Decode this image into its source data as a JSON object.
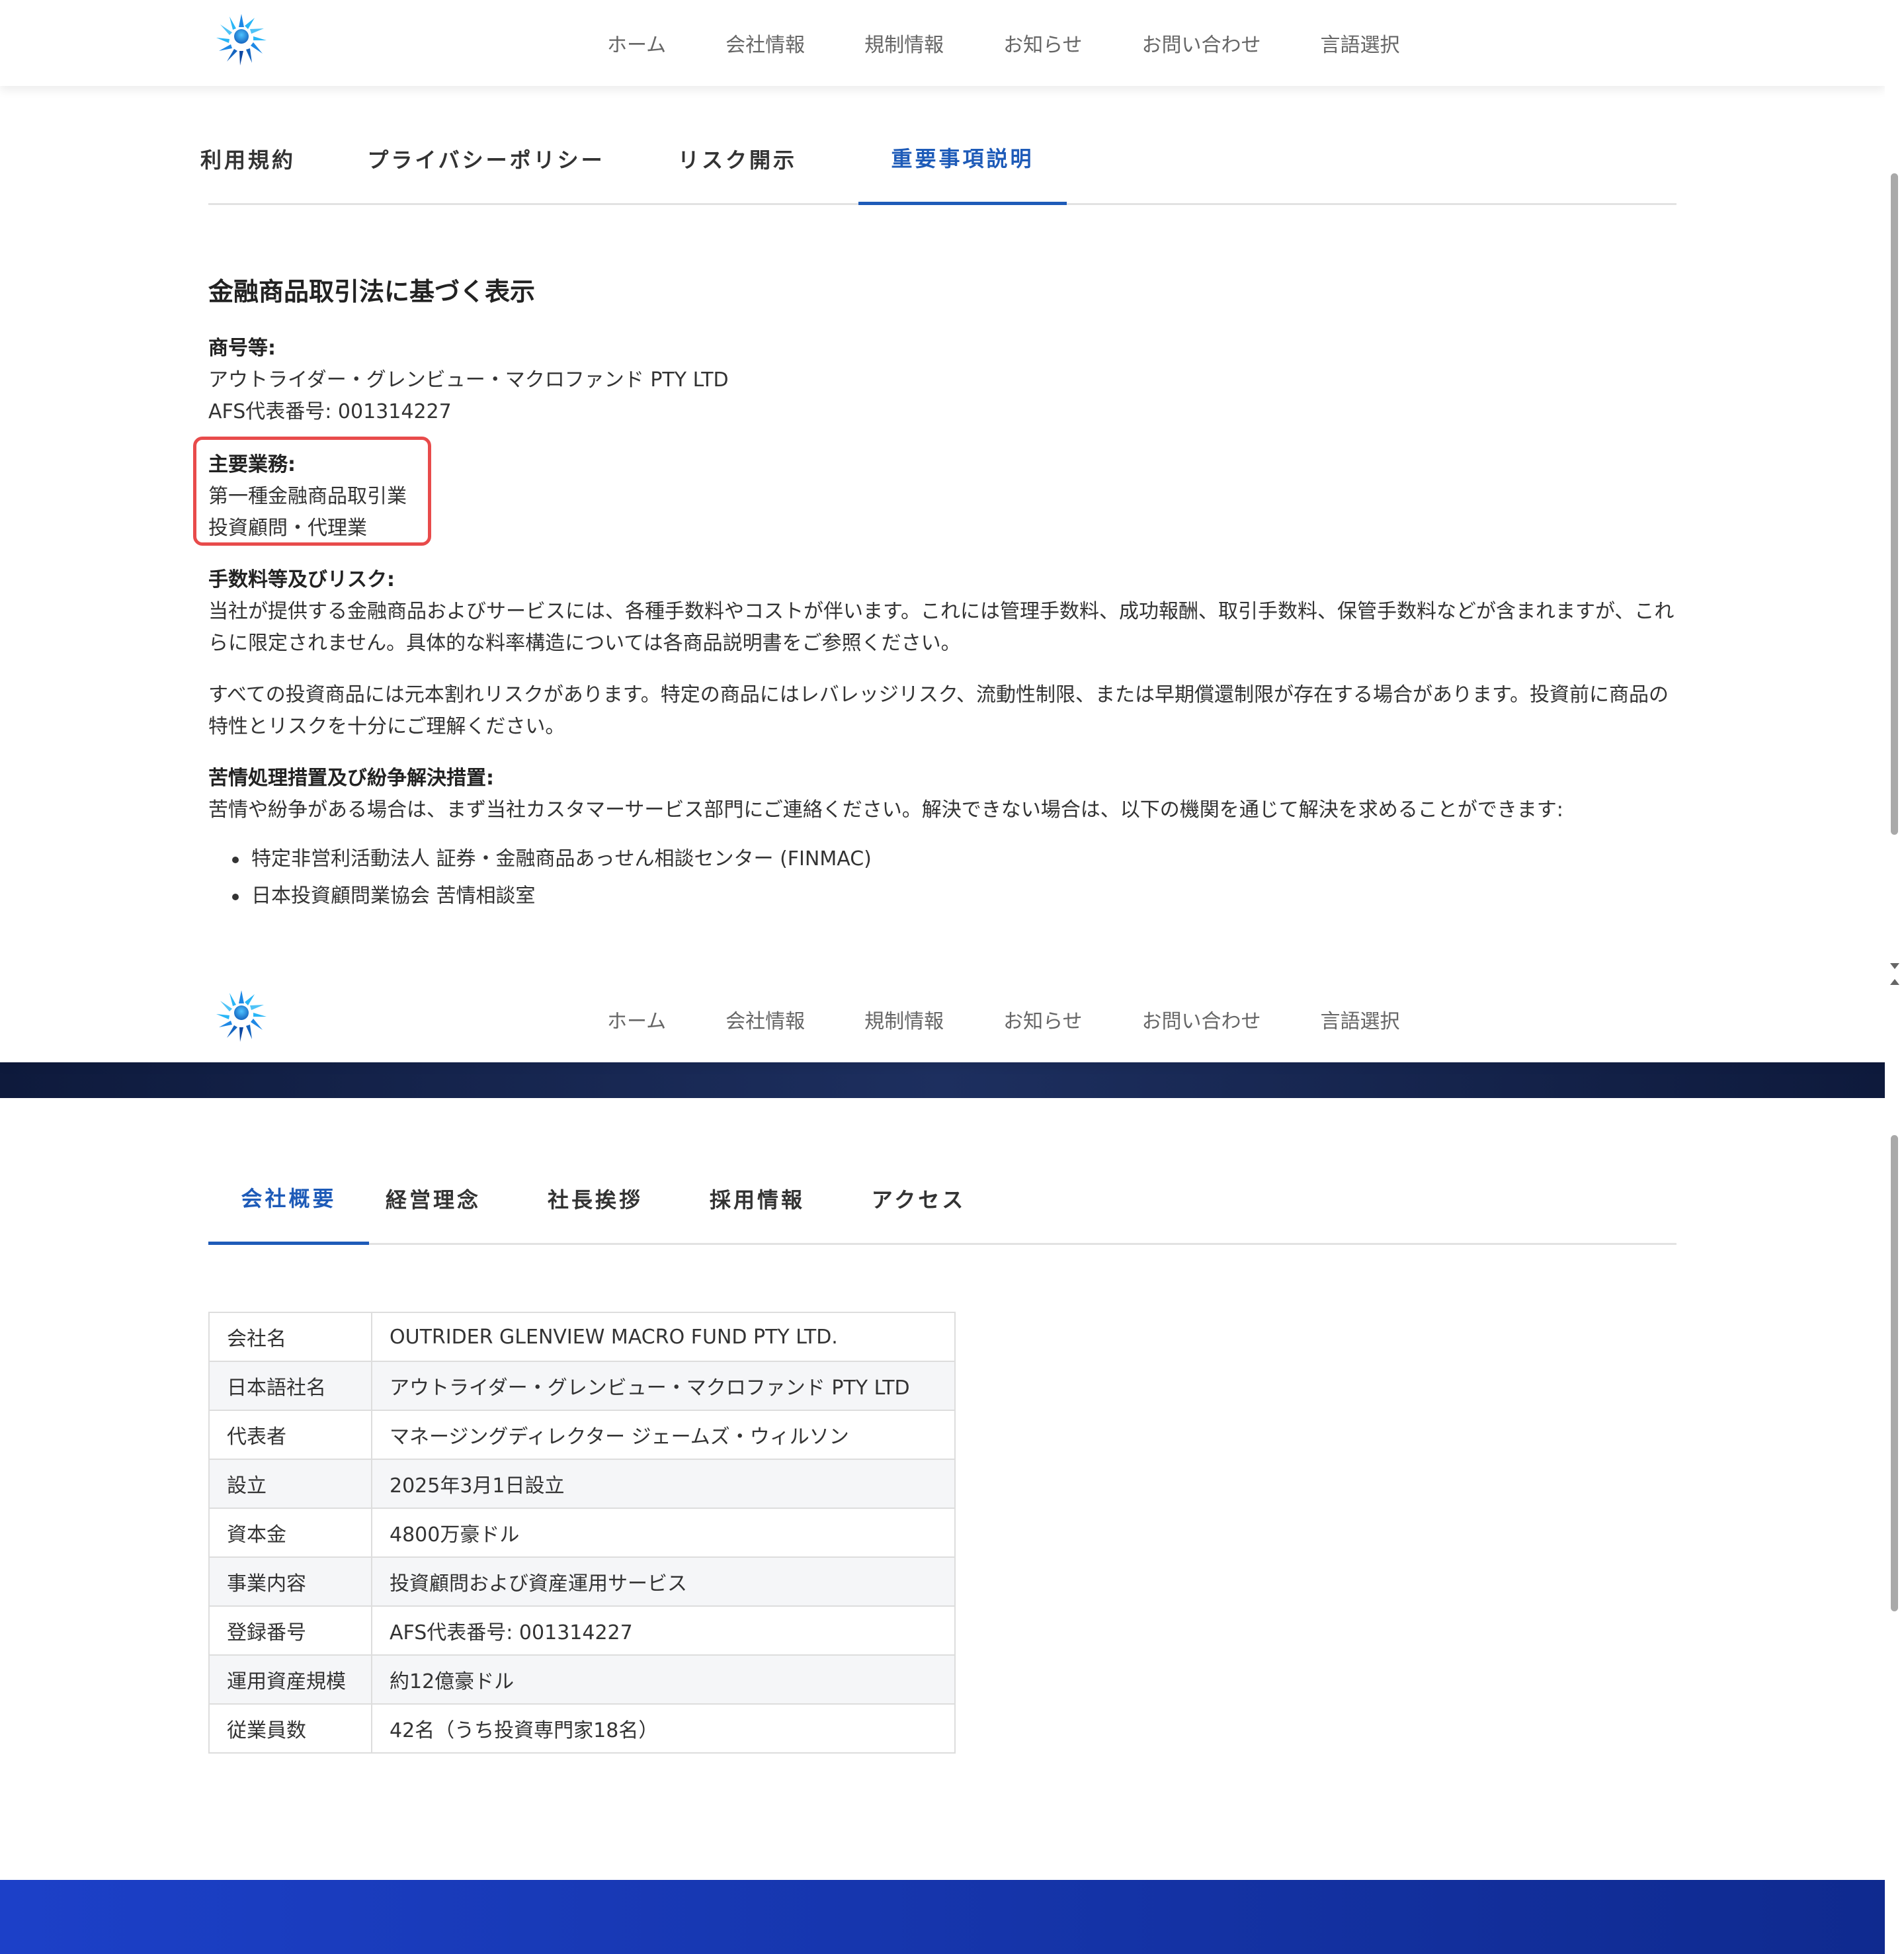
{
  "nav": [
    "ホーム",
    "会社情報",
    "規制情報",
    "お知らせ",
    "お問い合わせ",
    "言語選択"
  ],
  "pane1": {
    "tabs": [
      "利用規約",
      "プライバシーポリシー",
      "リスク開示",
      "重要事項説明"
    ],
    "active_tab": "重要事項説明",
    "heading": "金融商品取引法に基づく表示",
    "trade_name_label": "商号等:",
    "trade_name": "アウトライダー・グレンビュー・マクロファンド PTY LTD",
    "afs_number": "AFS代表番号: 001314227",
    "main_business_label": "主要業務:",
    "main_business": [
      "第一種金融商品取引業",
      "投資顧問・代理業"
    ],
    "fees_label": "手数料等及びリスク:",
    "fees_text": "当社が提供する金融商品およびサービスには、各種手数料やコストが伴います。これには管理手数料、成功報酬、取引手数料、保管手数料などが含まれますが、これらに限定されません。具体的な料率構造については各商品説明書をご参照ください。",
    "risk_text": "すべての投資商品には元本割れリスクがあります。特定の商品にはレバレッジリスク、流動性制限、または早期償還制限が存在する場合があります。投資前に商品の特性とリスクを十分にご理解ください。",
    "complaints_label": "苦情処理措置及び紛争解決措置:",
    "complaints_text": "苦情や紛争がある場合は、まず当社カスタマーサービス部門にご連絡ください。解決できない場合は、以下の機関を通じて解決を求めることができます:",
    "organizations": [
      "特定非営利活動法人 証券・金融商品あっせん相談センター (FINMAC)",
      "日本投資顧問業協会 苦情相談室"
    ]
  },
  "pane2": {
    "tabs": [
      "会社概要",
      "経営理念",
      "社長挨拶",
      "採用情報",
      "アクセス"
    ],
    "active_tab": "会社概要",
    "table": [
      [
        "会社名",
        "OUTRIDER GLENVIEW MACRO FUND PTY LTD."
      ],
      [
        "日本語社名",
        "アウトライダー・グレンビュー・マクロファンド PTY LTD"
      ],
      [
        "代表者",
        "マネージングディレクター ジェームズ・ウィルソン"
      ],
      [
        "設立",
        "2025年3月1日設立"
      ],
      [
        "資本金",
        "4800万豪ドル"
      ],
      [
        "事業内容",
        "投資顧問および資産運用サービス"
      ],
      [
        "登録番号",
        "AFS代表番号: 001314227"
      ],
      [
        "運用資産規模",
        "約12億豪ドル"
      ],
      [
        "従業員数",
        "42名（うち投資専門家18名）"
      ]
    ]
  },
  "icons": {
    "logo": "sunburst-globe-logo",
    "highlight_color": "#e84b4b",
    "accent_color": "#1e5bb8"
  }
}
